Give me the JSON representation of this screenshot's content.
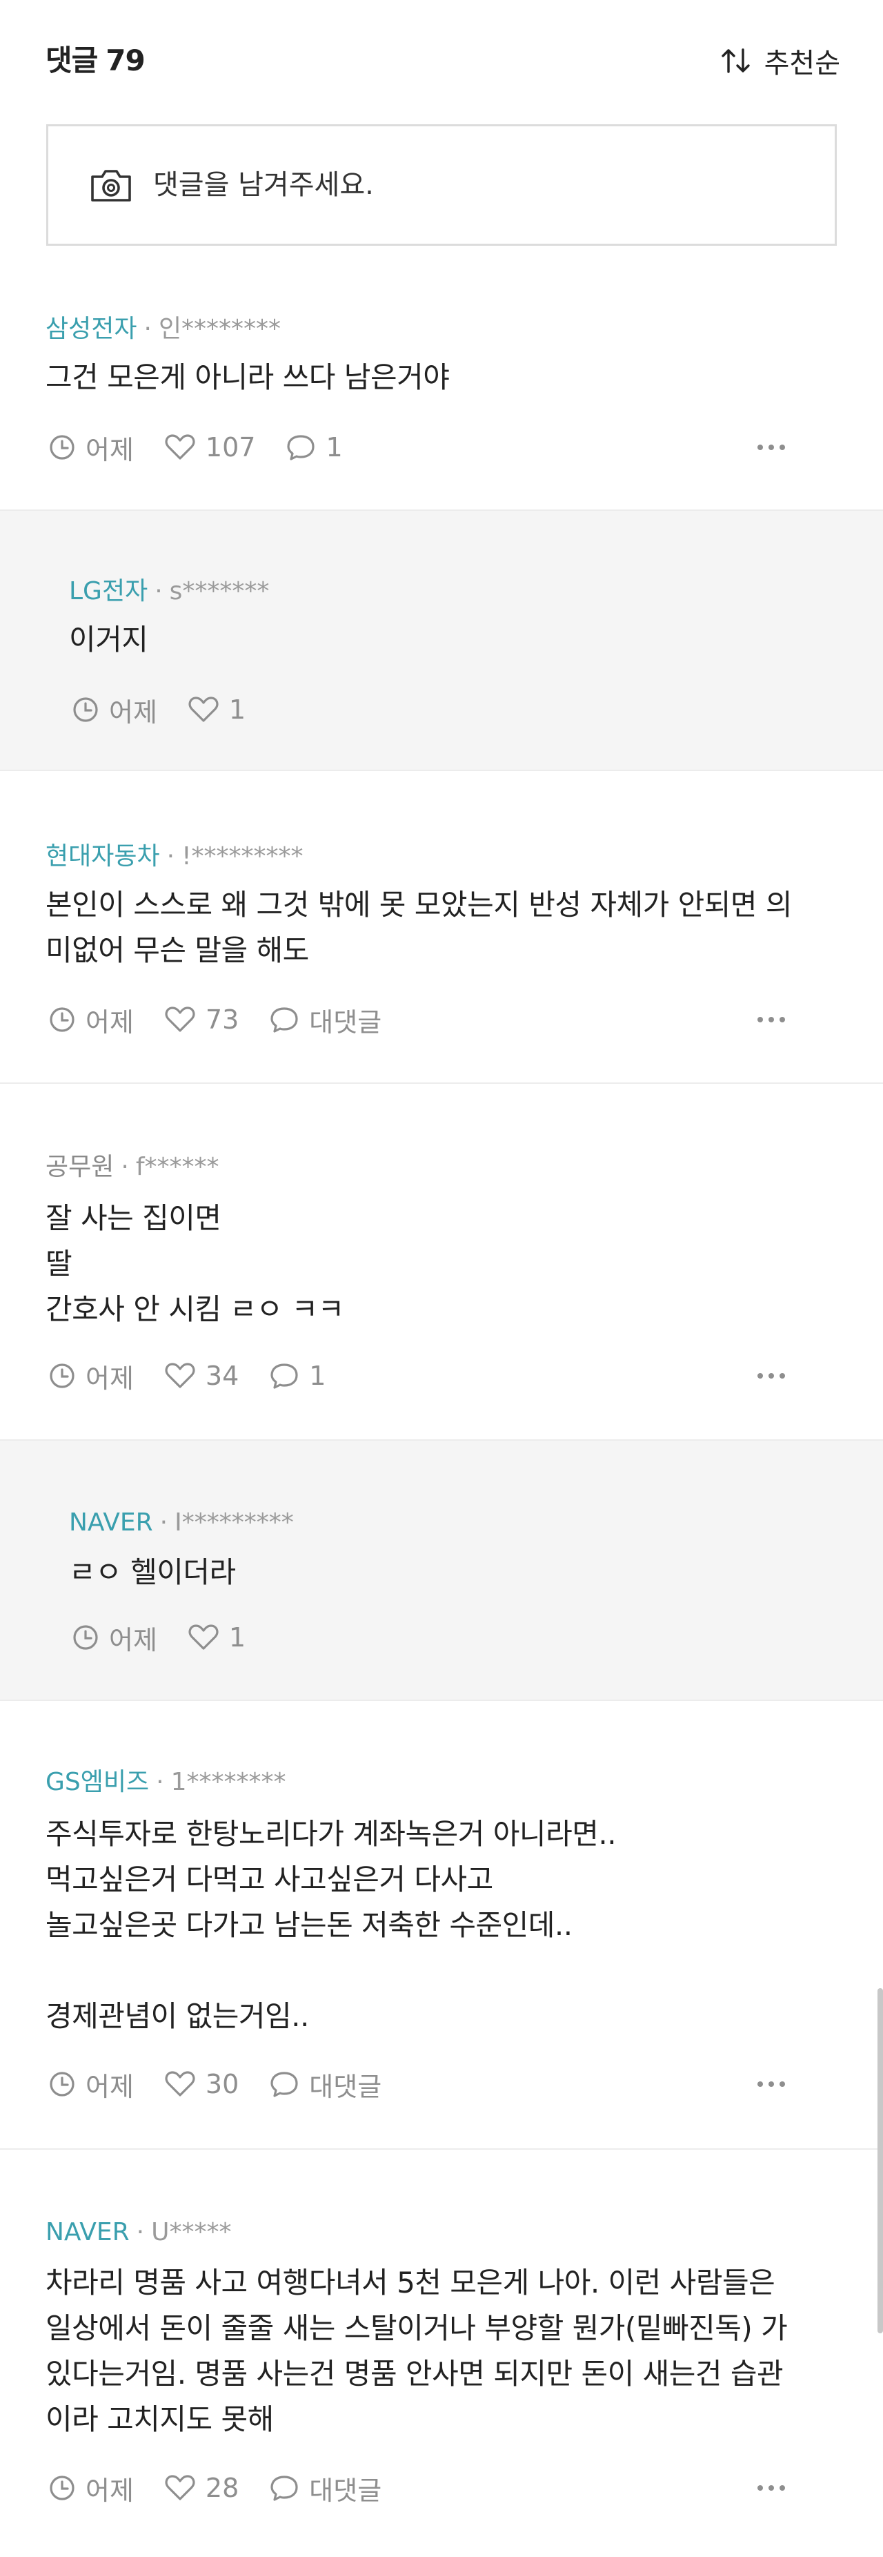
{
  "header": {
    "title": "댓글",
    "count": "79",
    "sort_label": "추천순"
  },
  "input": {
    "placeholder": "댓글을 남겨주세요."
  },
  "comments": [
    {
      "company": "삼성전자",
      "user": "인********",
      "text": "그건 모은게 아니라 쓰다 남은거야",
      "time": "어제",
      "likes": "107",
      "replies": "1"
    },
    {
      "company": "LG전자",
      "user": "s*******",
      "text": "이거지",
      "time": "어제",
      "likes": "1"
    },
    {
      "company": "현대자동차",
      "user": "!*********",
      "text": "본인이 스스로 왜 그것 밖에 못 모았는지 반성 자체가 안되면 의\n미없어 무슨 말을 해도",
      "time": "어제",
      "likes": "73",
      "replies": "대댓글"
    },
    {
      "company": "공무원",
      "user": "f******",
      "text": "잘 사는 집이면\n딸\n간호사 안 시킴 ㄹㅇ ㅋㅋ",
      "time": "어제",
      "likes": "34",
      "replies": "1"
    },
    {
      "company": "NAVER",
      "user": "I*********",
      "text": "ㄹㅇ 헬이더라",
      "time": "어제",
      "likes": "1"
    },
    {
      "company": "GS엠비즈",
      "user": "1********",
      "text": "주식투자로 한탕노리다가 계좌녹은거 아니라면..\n먹고싶은거 다먹고 사고싶은거 다사고\n놀고싶은곳 다가고 남는돈 저축한 수준인데..\n\n경제관념이 없는거임..",
      "time": "어제",
      "likes": "30",
      "replies": "대댓글"
    },
    {
      "company": "NAVER",
      "user": "U*****",
      "text": "차라리 명품 사고 여행다녀서 5천 모은게 나아. 이런 사람들은\n일상에서 돈이 줄줄 새는 스탈이거나 부양할 뭔가(밑빠진독) 가\n있다는거임. 명품 사는건 명품 안사면 되지만 돈이 새는건 습관\n이라 고치지도 못해",
      "time": "어제",
      "likes": "28",
      "replies": "대댓글"
    }
  ],
  "colors": {
    "company": "#3a9fae",
    "muted": "#8e8e8e",
    "reply_bg": "#f5f5f5"
  },
  "icons": {
    "sort": "sort-arrows-icon",
    "camera": "camera-icon",
    "clock": "clock-icon",
    "heart": "heart-icon",
    "reply": "speech-bubble-icon",
    "more": "more-dots-icon"
  }
}
